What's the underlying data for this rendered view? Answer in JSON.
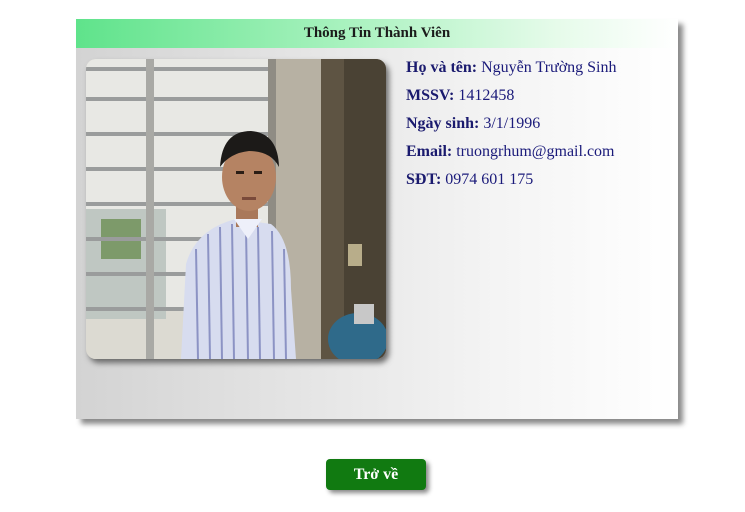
{
  "card": {
    "title": "Thông Tin Thành Viên",
    "fields": [
      {
        "label": "Họ và tên:",
        "value": "Nguyễn Trường Sinh"
      },
      {
        "label": "MSSV:",
        "value": "1412458"
      },
      {
        "label": "Ngày sinh:",
        "value": "3/1/1996"
      },
      {
        "label": "Email:",
        "value": "truongrhum@gmail.com"
      },
      {
        "label": "SĐT:",
        "value": "0974 601 175"
      }
    ]
  },
  "back_button": {
    "label": "Trở về"
  },
  "colors": {
    "header_accent": "#5fe38b",
    "button_bg": "#117a11",
    "text": "#1a1a7a"
  }
}
